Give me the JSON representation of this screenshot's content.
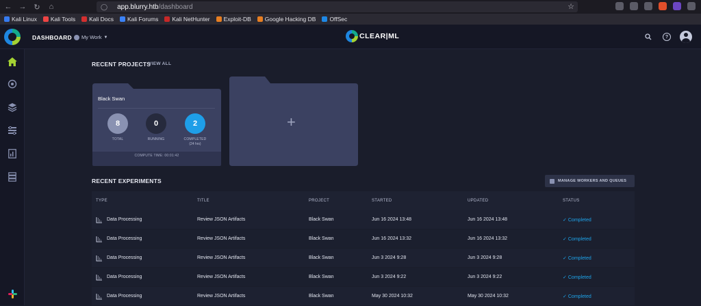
{
  "browser": {
    "url_host": "app.blurry.htb",
    "url_path": "/dashboard",
    "bookmarks": [
      {
        "label": "Kali Linux",
        "color": "#367bf0"
      },
      {
        "label": "Kali Tools",
        "color": "#ee4444"
      },
      {
        "label": "Kali Docs",
        "color": "#d32f2f"
      },
      {
        "label": "Kali Forums",
        "color": "#3b82f6"
      },
      {
        "label": "Kali NetHunter",
        "color": "#c62828"
      },
      {
        "label": "Exploit-DB",
        "color": "#e67e22"
      },
      {
        "label": "Google Hacking DB",
        "color": "#e67e22"
      },
      {
        "label": "OffSec",
        "color": "#1e88e5"
      }
    ]
  },
  "header": {
    "title": "DASHBOARD",
    "my_work": "My Work",
    "logo_text": "CLEAR|ML"
  },
  "projects": {
    "section_title": "RECENT PROJECTS",
    "view_all": "VIEW ALL",
    "card": {
      "name": "Black Swan",
      "stats": [
        {
          "value": "8",
          "label": "TOTAL",
          "sub": "",
          "color": "#8a92b2"
        },
        {
          "value": "0",
          "label": "RUNNING",
          "sub": "",
          "color": "#262a3d"
        },
        {
          "value": "2",
          "label": "COMPLETED",
          "sub": "(24 hrs)",
          "color": "#1e9ee8"
        }
      ],
      "compute_time": "COMPUTE TIME: 00:01:42"
    },
    "new_project": "+"
  },
  "experiments": {
    "section_title": "RECENT EXPERIMENTS",
    "manage_button": "MANAGE WORKERS AND QUEUES",
    "columns": [
      "TYPE",
      "TITLE",
      "PROJECT",
      "STARTED",
      "UPDATED",
      "STATUS"
    ],
    "rows": [
      {
        "type": "Data Processing",
        "title": "Review JSON Artifacts",
        "project": "Black Swan",
        "started": "Jun 16 2024 13:48",
        "updated": "Jun 16 2024 13:48",
        "status": "Completed"
      },
      {
        "type": "Data Processing",
        "title": "Review JSON Artifacts",
        "project": "Black Swan",
        "started": "Jun 16 2024 13:32",
        "updated": "Jun 16 2024 13:32",
        "status": "Completed"
      },
      {
        "type": "Data Processing",
        "title": "Review JSON Artifacts",
        "project": "Black Swan",
        "started": "Jun 3 2024 9:28",
        "updated": "Jun 3 2024 9:28",
        "status": "Completed"
      },
      {
        "type": "Data Processing",
        "title": "Review JSON Artifacts",
        "project": "Black Swan",
        "started": "Jun 3 2024 9:22",
        "updated": "Jun 3 2024 9:22",
        "status": "Completed"
      },
      {
        "type": "Data Processing",
        "title": "Review JSON Artifacts",
        "project": "Black Swan",
        "started": "May 30 2024 10:32",
        "updated": "May 30 2024 10:32",
        "status": "Completed"
      }
    ]
  },
  "colors": {
    "accent": "#1e9ee8",
    "home_active": "#a4d233"
  }
}
